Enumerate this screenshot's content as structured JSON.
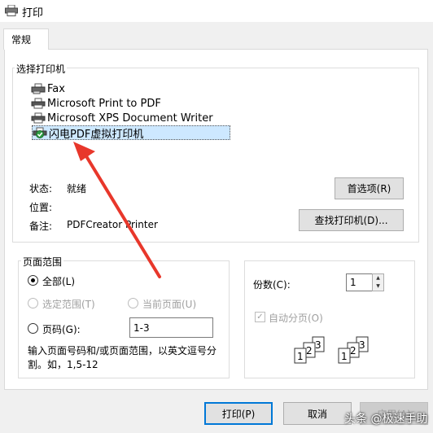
{
  "window": {
    "title": "打印"
  },
  "tabs": [
    {
      "label": "常规"
    }
  ],
  "printer_group": {
    "legend": "选择打印机",
    "printers": [
      {
        "name": "Fax",
        "icon": "fax-icon"
      },
      {
        "name": "Microsoft Print to PDF",
        "icon": "printer-icon"
      },
      {
        "name": "Microsoft XPS Document Writer",
        "icon": "printer-icon"
      },
      {
        "name": "闪电PDF虚拟打印机",
        "icon": "default-printer-icon",
        "selected": true
      }
    ],
    "status_label": "状态:",
    "status_value": "就绪",
    "location_label": "位置:",
    "location_value": "",
    "comment_label": "备注:",
    "comment_value": "PDFCreator Printer",
    "preferences_button": "首选项(R)",
    "find_printer_button": "查找打印机(D)..."
  },
  "page_range": {
    "legend": "页面范围",
    "all": "全部(L)",
    "selection": "选定范围(T)",
    "current_page": "当前页面(U)",
    "pages": "页码(G):",
    "pages_value": "1-3",
    "hint": "输入页面号码和/或页面范围，以英文逗号分割。如，1,5-12"
  },
  "copies": {
    "label": "份数(C):",
    "value": "1",
    "collate": "自动分页(O)"
  },
  "footer": {
    "print_button": "打印(P)",
    "cancel_button": "取消",
    "apply_button": "应用(A)"
  },
  "watermark": "头条 @极速手助",
  "colors": {
    "accent": "#0078d7",
    "selection": "#cde8ff",
    "arrow": "#e8372b",
    "dialog_bg": "#f0f0f0"
  }
}
